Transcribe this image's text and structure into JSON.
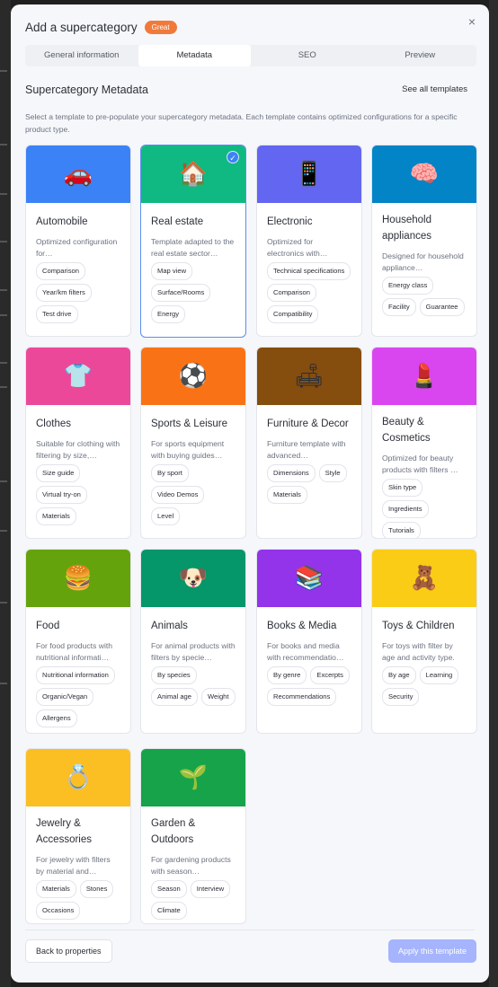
{
  "modal": {
    "title": "Add a supercategory",
    "badge": "Great",
    "close_icon": "×"
  },
  "tabs": [
    {
      "label": "General information",
      "active": false
    },
    {
      "label": "Metadata",
      "active": true
    },
    {
      "label": "SEO",
      "active": false
    },
    {
      "label": "Preview",
      "active": false
    }
  ],
  "section": {
    "title": "Supercategory Metadata",
    "see_all": "See all templates",
    "description": "Select a template to pre-populate your supercategory metadata. Each template contains optimized configurations for a specific product type."
  },
  "templates": [
    {
      "name": "Automobile",
      "desc": "Optimized configuration for…",
      "emoji": "🚗",
      "color": "#3b82f6",
      "icon": "car-icon",
      "tags": [
        "Comparison",
        "Year/km filters",
        "Test drive"
      ]
    },
    {
      "name": "Real estate",
      "desc": "Template adapted to the real estate sector…",
      "emoji": "🏠",
      "color": "#10b981",
      "icon": "house-icon",
      "selected": true,
      "tags": [
        "Map view",
        "Surface/Rooms",
        "Energy"
      ]
    },
    {
      "name": "Electronic",
      "desc": "Optimized for electronics with…",
      "emoji": "📱",
      "color": "#6366f1",
      "icon": "phone-icon",
      "tags": [
        "Technical specifications",
        "Comparison",
        "Compatibility"
      ]
    },
    {
      "name": "Household appliances",
      "desc": "Designed for household appliance…",
      "emoji": "🧠",
      "color": "#0284c7",
      "icon": "brain-icon",
      "tags": [
        "Energy class",
        "Facility",
        "Guarantee"
      ]
    },
    {
      "name": "Clothes",
      "desc": "Suitable for clothing with filtering by size,…",
      "emoji": "👕",
      "color": "#ec4899",
      "icon": "tshirt-icon",
      "tags": [
        "Size guide",
        "Virtual try-on",
        "Materials"
      ]
    },
    {
      "name": "Sports & Leisure",
      "desc": "For sports equipment with buying guides…",
      "emoji": "⚽",
      "color": "#f97316",
      "icon": "soccer-ball-icon",
      "tags": [
        "By sport",
        "Video Demos",
        "Level"
      ]
    },
    {
      "name": "Furniture & Decor",
      "desc": "Furniture template with advanced…",
      "emoji": "🛋",
      "color": "#854d0e",
      "icon": "couch-icon",
      "tags": [
        "Dimensions",
        "Style",
        "Materials"
      ]
    },
    {
      "name": "Beauty & Cosmetics",
      "desc": "Optimized for beauty products with filters …",
      "emoji": "💄",
      "color": "#d946ef",
      "icon": "lipstick-icon",
      "tags": [
        "Skin type",
        "Ingredients",
        "Tutorials"
      ]
    },
    {
      "name": "Food",
      "desc": "For food products with nutritional informati…",
      "emoji": "🍔",
      "color": "#65a30d",
      "icon": "burger-icon",
      "tags": [
        "Nutritional information",
        "Organic/Vegan",
        "Allergens"
      ]
    },
    {
      "name": "Animals",
      "desc": "For animal products with filters by specie…",
      "emoji": "🐶",
      "color": "#059669",
      "icon": "dog-icon",
      "tags": [
        "By species",
        "Animal age",
        "Weight"
      ]
    },
    {
      "name": "Books & Media",
      "desc": "For books and media with recommendatio…",
      "emoji": "📚",
      "color": "#9333ea",
      "icon": "books-icon",
      "tags": [
        "By genre",
        "Excerpts",
        "Recommendations"
      ]
    },
    {
      "name": "Toys & Children",
      "desc": "For toys with filter by age and activity type.",
      "emoji": "🧸",
      "color": "#facc15",
      "icon": "teddy-bear-icon",
      "tags": [
        "By age",
        "Learning",
        "Security"
      ]
    },
    {
      "name": "Jewelry & Accessories",
      "desc": "For jewelry with filters by material and…",
      "emoji": "💍",
      "color": "#fbbf24",
      "icon": "ring-icon",
      "tags": [
        "Materials",
        "Stones",
        "Occasions"
      ]
    },
    {
      "name": "Garden & Outdoors",
      "desc": "For gardening products with season…",
      "emoji": "🌱",
      "color": "#16a34a",
      "icon": "seedling-icon",
      "tags": [
        "Season",
        "Interview",
        "Climate"
      ]
    }
  ],
  "footer": {
    "back_label": "Back to properties",
    "apply_label": "Apply this template"
  }
}
